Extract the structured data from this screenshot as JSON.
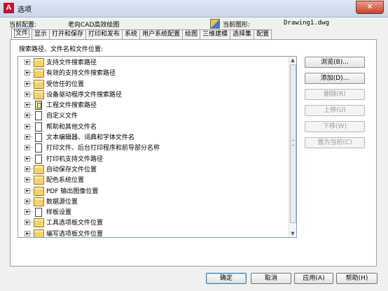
{
  "window": {
    "title": "选项",
    "close_glyph": "✕",
    "logo_glyph": "A"
  },
  "header": {
    "profile_label": "当前配置:",
    "profile_value": "老向CAD高效绘图",
    "drawing_label": "当前图形:",
    "drawing_value": "Drawing1.dwg"
  },
  "tabs": [
    {
      "label": "文件",
      "active": true
    },
    {
      "label": "显示"
    },
    {
      "label": "打开和保存"
    },
    {
      "label": "打印和发布"
    },
    {
      "label": "系统"
    },
    {
      "label": "用户系统配置"
    },
    {
      "label": "绘图"
    },
    {
      "label": "三维建模"
    },
    {
      "label": "选择集"
    },
    {
      "label": "配置"
    }
  ],
  "panel": {
    "path_label": "搜索路径、文件名和文件位置:"
  },
  "tree_items": [
    {
      "label": "支持文件搜索路径",
      "icon": "folder-icon"
    },
    {
      "label": "有效的支持文件搜索路径",
      "icon": "folder-icon"
    },
    {
      "label": "受信任的位置",
      "icon": "folder-icon"
    },
    {
      "label": "设备驱动程序文件搜索路径",
      "icon": "folder-icon"
    },
    {
      "label": "工程文件搜索路径",
      "icon": "project-icon"
    },
    {
      "label": "自定义文件",
      "icon": "file-icon"
    },
    {
      "label": "帮助和其他文件名",
      "icon": "file-icon"
    },
    {
      "label": "文本编辑器、词典和字体文件名",
      "icon": "file-icon"
    },
    {
      "label": "打印文件、后台打印程序和前导部分名称",
      "icon": "file-icon"
    },
    {
      "label": "打印机支持文件路径",
      "icon": "file-icon"
    },
    {
      "label": "自动保存文件位置",
      "icon": "folder-icon"
    },
    {
      "label": "配色系统位置",
      "icon": "folder-icon"
    },
    {
      "label": "PDF 输出图像位置",
      "icon": "folder-icon"
    },
    {
      "label": "数据源位置",
      "icon": "folder-icon"
    },
    {
      "label": "样板设置",
      "icon": "file-icon"
    },
    {
      "label": "工具选项板文件位置",
      "icon": "folder-icon"
    },
    {
      "label": "编写选项板文件位置",
      "icon": "folder-icon"
    }
  ],
  "side_buttons": {
    "browse": "浏览(B)...",
    "add": "添加(D)...",
    "remove": "删除(R)",
    "move_up": "上移(U)",
    "move_down": "下移(W)",
    "set_current": "置为当前(C)"
  },
  "bottom_buttons": {
    "ok": "确定",
    "cancel": "取消",
    "apply": "应用(A)",
    "help": "帮助(H)"
  },
  "scrollbar": {
    "up_glyph": "▲",
    "down_glyph": "▼"
  }
}
